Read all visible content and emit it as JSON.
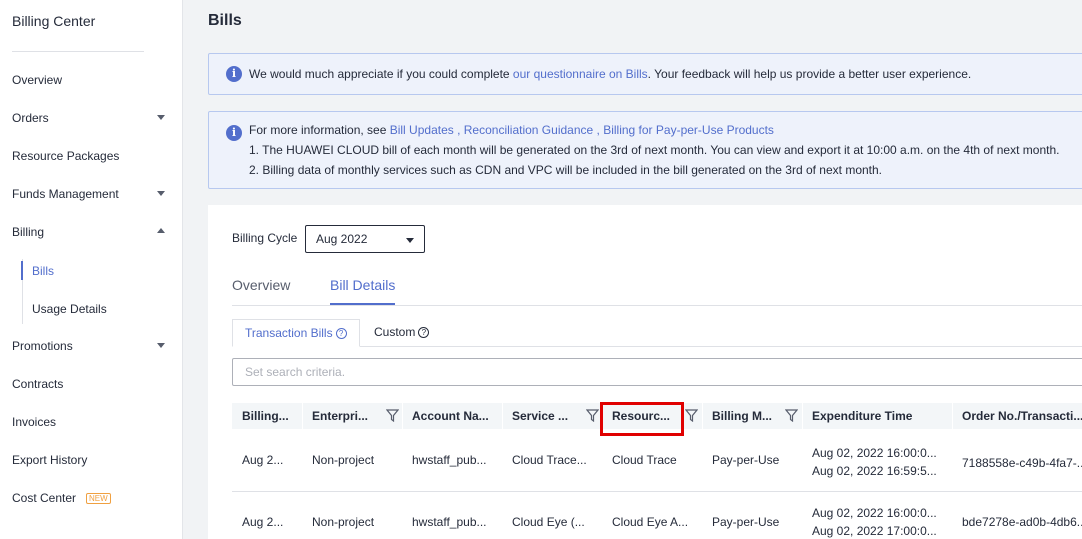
{
  "sidebar": {
    "title": "Billing Center",
    "items": [
      {
        "label": "Overview"
      },
      {
        "label": "Orders"
      },
      {
        "label": "Resource Packages"
      },
      {
        "label": "Funds Management"
      },
      {
        "label": "Billing"
      },
      {
        "label": "Promotions"
      },
      {
        "label": "Contracts"
      },
      {
        "label": "Invoices"
      },
      {
        "label": "Export History"
      },
      {
        "label": "Cost Center",
        "badge": "NEW"
      }
    ],
    "billing_children": [
      {
        "label": "Bills"
      },
      {
        "label": "Usage Details"
      }
    ]
  },
  "page": {
    "title": "Bills"
  },
  "notice1": {
    "prefix": "We would much appreciate if you could complete ",
    "link": "our questionnaire on Bills",
    "suffix": ". Your feedback will help us provide a better user experience."
  },
  "notice2": {
    "prefix": "For more information, see ",
    "link1": "Bill Updates",
    "sep1": " , ",
    "link2": "Reconciliation Guidance",
    "sep2": " , ",
    "link3": "Billing for Pay-per-Use Products",
    "line1": "1. The HUAWEI CLOUD bill of each month will be generated on the 3rd of next month. You can view and export it at 10:00 a.m. on the 4th of next month.",
    "line2": "2. Billing data of monthly services such as CDN and VPC will be included in the bill generated on the 3rd of next month."
  },
  "billing_cycle": {
    "label": "Billing Cycle",
    "value": "Aug 2022"
  },
  "tabs": [
    {
      "label": "Overview"
    },
    {
      "label": "Bill Details"
    }
  ],
  "subtabs": [
    {
      "label": "Transaction Bills",
      "help": "?"
    },
    {
      "label": "Custom",
      "help": "?"
    }
  ],
  "search": {
    "placeholder": "Set search criteria."
  },
  "table": {
    "columns": [
      "Billing...",
      "Enterpri...",
      "Account Na...",
      "Service ...",
      "Resourc...",
      "Billing M...",
      "Expenditure Time",
      "Order No./Transacti..."
    ],
    "rows": [
      {
        "billing": "Aug 2...",
        "enterprise": "Non-project",
        "account": "hwstaff_pub...",
        "service": "Cloud Trace...",
        "resource": "Cloud Trace",
        "mode": "Pay-per-Use",
        "time1": "Aug 02, 2022 16:00:0...",
        "time2": "Aug 02, 2022 16:59:5...",
        "order": "7188558e-c49b-4fa7-..."
      },
      {
        "billing": "Aug 2...",
        "enterprise": "Non-project",
        "account": "hwstaff_pub...",
        "service": "Cloud Eye (...",
        "resource": "Cloud Eye A...",
        "mode": "Pay-per-Use",
        "time1": "Aug 02, 2022 16:00:0...",
        "time2": "Aug 02, 2022 17:00:0...",
        "order": "bde7278e-ad0b-4db6..."
      }
    ]
  },
  "colors": {
    "accent": "#526ecc",
    "highlight": "#e00000"
  }
}
